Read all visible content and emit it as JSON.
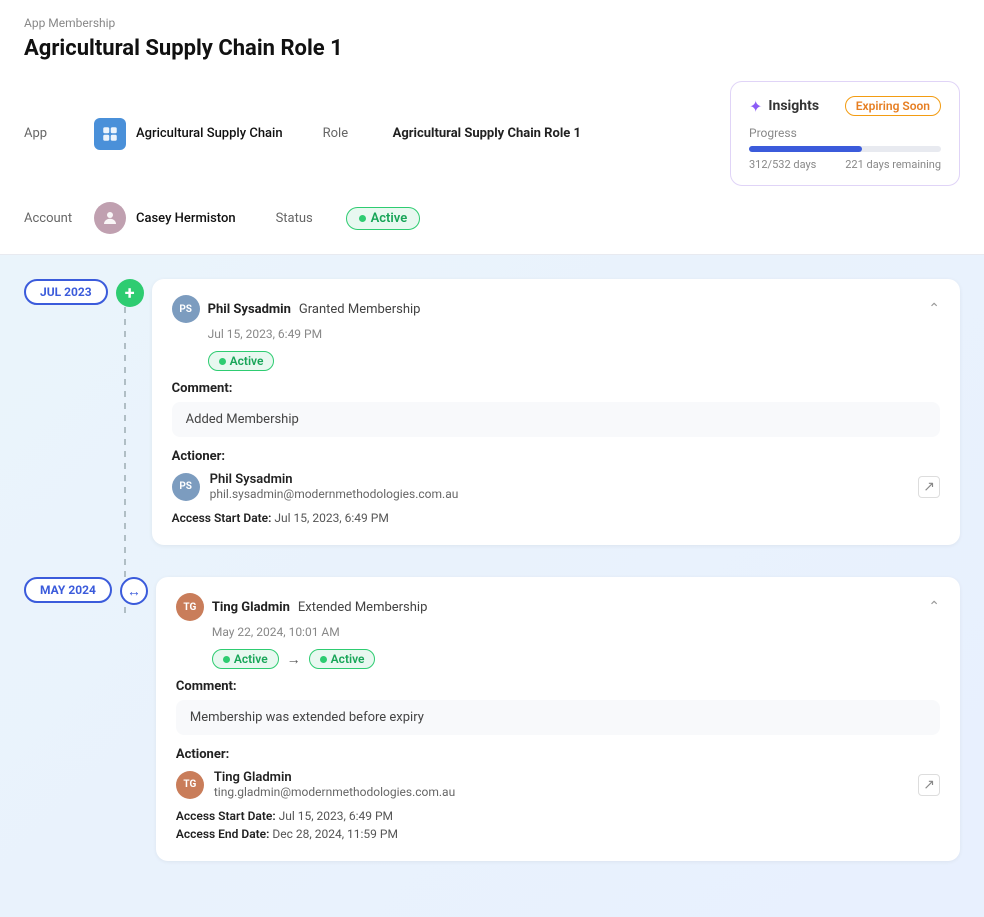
{
  "breadcrumb": "App Membership",
  "page_title": "Agricultural Supply Chain Role 1",
  "app_label": "App",
  "app_value": "Agricultural Supply Chain",
  "role_label": "Role",
  "role_value": "Agricultural Supply Chain Role 1",
  "account_label": "Account",
  "account_value": "Casey Hermiston",
  "status_label": "Status",
  "status_value": "Active",
  "insights": {
    "title": "Insights",
    "expiring_label": "Expiring Soon",
    "progress_label": "Progress",
    "days_used": "312/532 days",
    "days_remaining": "221 days remaining",
    "progress_percent": 58.6
  },
  "timeline": [
    {
      "date_badge": "JUL 2023",
      "icon_type": "green",
      "actor_initials": "PS",
      "actor_color": "#7c9cbf",
      "actor_name": "Phil Sysadmin",
      "action": "Granted Membership",
      "timestamp": "Jul 15, 2023, 6:49 PM",
      "status_from": null,
      "status_to": "Active",
      "comment_label": "Comment:",
      "comment": "Added Membership",
      "actioner_label": "Actioner:",
      "actioner_initials": "PS",
      "actioner_color": "#7c9cbf",
      "actioner_name": "Phil Sysadmin",
      "actioner_email": "phil.sysadmin@modernmethodologies.com.au",
      "access_start_label": "Access Start Date:",
      "access_start": "Jul 15, 2023, 6:49 PM",
      "access_end_label": null,
      "access_end": null
    },
    {
      "date_badge": "MAY 2024",
      "icon_type": "extend",
      "actor_initials": "TG",
      "actor_color": "#c97d5a",
      "actor_name": "Ting Gladmin",
      "action": "Extended Membership",
      "timestamp": "May 22, 2024, 10:01 AM",
      "status_from": "Active",
      "status_to": "Active",
      "comment_label": "Comment:",
      "comment": "Membership was extended before expiry",
      "actioner_label": "Actioner:",
      "actioner_initials": "TG",
      "actioner_color": "#c97d5a",
      "actioner_name": "Ting Gladmin",
      "actioner_email": "ting.gladmin@modernmethodologies.com.au",
      "access_start_label": "Access Start Date:",
      "access_start": "Jul 15, 2023, 6:49 PM",
      "access_end_label": "Access End Date:",
      "access_end": "Dec 28, 2024, 11:59 PM"
    }
  ]
}
